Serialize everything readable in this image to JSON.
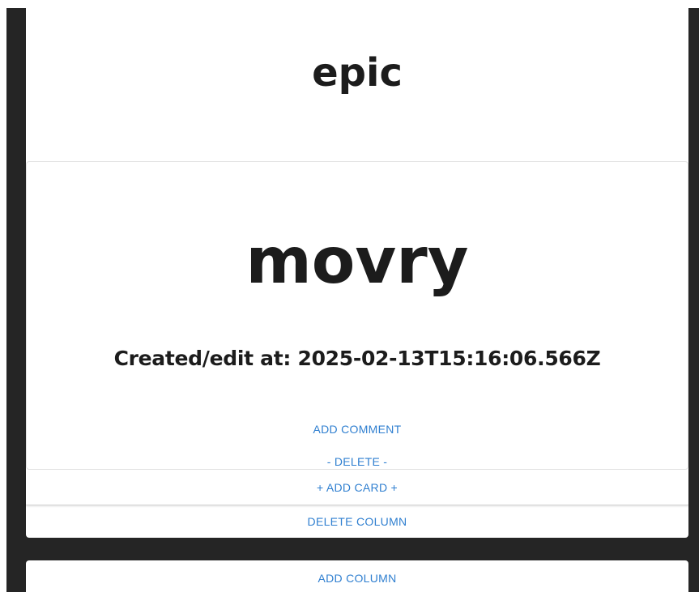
{
  "column": {
    "title": "epic",
    "delete_label": "DELETE COLUMN",
    "add_card_label": "+ ADD CARD +",
    "cards": [
      {
        "title": "movry",
        "created_label": "Created/edit at: 2025-02-13T15:16:06.566Z",
        "add_comment_label": "ADD COMMENT",
        "delete_label": "- DELETE -"
      }
    ]
  },
  "board": {
    "add_column_label": "ADD COLUMN"
  },
  "colors": {
    "background": "#252525",
    "panel": "#ffffff",
    "link": "#2f7fd0",
    "text": "#1c1c1c"
  }
}
